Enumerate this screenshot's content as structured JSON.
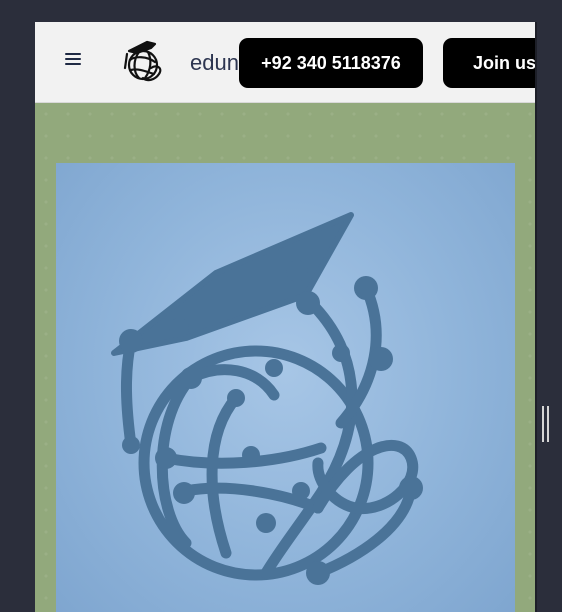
{
  "header": {
    "brand_text": "edun",
    "phone_label": "+92 340 5118376",
    "join_label": "Join us",
    "menu_icon": "hamburger-menu-icon",
    "logo_icon": "graduation-globe-logo-icon"
  },
  "hero": {
    "illustration_icon": "graduation-cap-globe-icon"
  },
  "colors": {
    "header_bg": "#f2f2f2",
    "button_bg": "#000000",
    "hero_bg": "#92a97c",
    "card_bg": "#93b8dc",
    "illustration": "#4a7398",
    "page_bg": "#2b2e3b"
  }
}
